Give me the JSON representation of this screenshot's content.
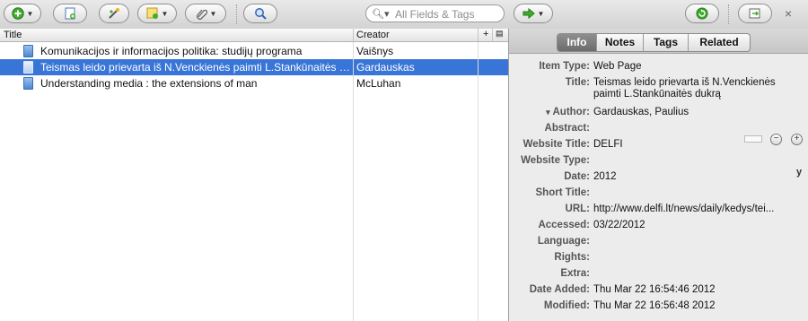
{
  "toolbar": {
    "new_collection_icon": "add-circle-icon",
    "new_item_icon": "new-item-page-icon",
    "add_by_identifier_icon": "wand-icon",
    "new_note_icon": "note-icon",
    "attach_icon": "paperclip-icon",
    "locate_icon": "magnifier-icon",
    "search_placeholder": "All Fields & Tags",
    "search_value": "",
    "go_icon": "green-arrow-icon",
    "sync_icon": "sync-icon",
    "fullscreen_icon": "fullscreen-icon",
    "close_label": "×"
  },
  "items_pane": {
    "columns": [
      "Title",
      "Creator"
    ],
    "column_add_label": "+",
    "rows": [
      {
        "title": "Komunikacijos ir informacijos politika: studijų programa",
        "creator": "Vaišnys",
        "selected": false
      },
      {
        "title": "Teismas leido prievarta iš N.Venckienės paimti L.Stankūnaitės dukrą",
        "creator": "Gardauskas",
        "selected": true
      },
      {
        "title": "Understanding media : the extensions of man",
        "creator": "McLuhan",
        "selected": false
      }
    ]
  },
  "info_pane": {
    "tabs": [
      "Info",
      "Notes",
      "Tags",
      "Related"
    ],
    "active_tab": "Info",
    "fields": {
      "item_type_label": "Item Type:",
      "item_type": "Web Page",
      "title_label": "Title:",
      "title": "Teismas leido prievarta iš N.Venckienės paimti L.Stankūnaitės dukrą",
      "author_label": "Author:",
      "author": "Gardauskas, Paulius",
      "abstract_label": "Abstract:",
      "abstract": "",
      "website_title_label": "Website Title:",
      "website_title": "DELFI",
      "website_type_label": "Website Type:",
      "website_type": "",
      "date_label": "Date:",
      "date": "2012",
      "date_format": "y",
      "short_title_label": "Short Title:",
      "short_title": "",
      "url_label": "URL:",
      "url": "http://www.delfi.lt/news/daily/kedys/tei...",
      "accessed_label": "Accessed:",
      "accessed": "03/22/2012",
      "language_label": "Language:",
      "language": "",
      "rights_label": "Rights:",
      "rights": "",
      "extra_label": "Extra:",
      "extra": "",
      "date_added_label": "Date Added:",
      "date_added": "Thu Mar 22 16:54:46 2012",
      "modified_label": "Modified:",
      "modified": "Thu Mar 22 16:56:48 2012"
    },
    "author_minus": "−",
    "author_plus": "+",
    "author_caret": "▾"
  }
}
